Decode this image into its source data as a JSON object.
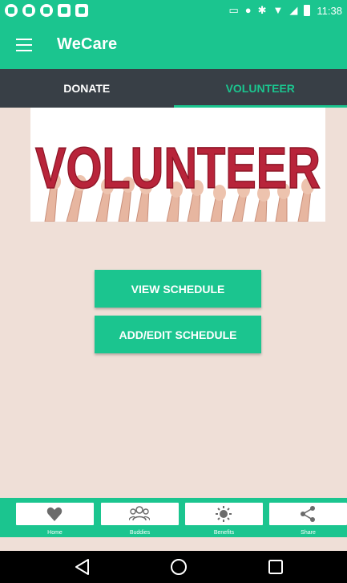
{
  "status_bar": {
    "time": "11:38"
  },
  "app_bar": {
    "title": "WeCare"
  },
  "tabs": [
    {
      "label": "DONATE",
      "active": false
    },
    {
      "label": "VOLUNTEER",
      "active": true
    }
  ],
  "hero": {
    "word": "VOLUNTEER"
  },
  "actions": {
    "view_schedule": "VIEW SCHEDULE",
    "add_edit_schedule": "ADD/EDIT SCHEDULE"
  },
  "bottom_nav": {
    "items": [
      {
        "label": "Home",
        "icon": "heart-icon"
      },
      {
        "label": "Buddies",
        "icon": "people-icon"
      },
      {
        "label": "Benefits",
        "icon": "sun-icon"
      },
      {
        "label": "Share",
        "icon": "share-icon"
      }
    ]
  },
  "colors": {
    "accent": "#1bc58f",
    "tab_bar": "#383f46",
    "background": "#efdfd7",
    "hero_letters": "#b8243a"
  }
}
